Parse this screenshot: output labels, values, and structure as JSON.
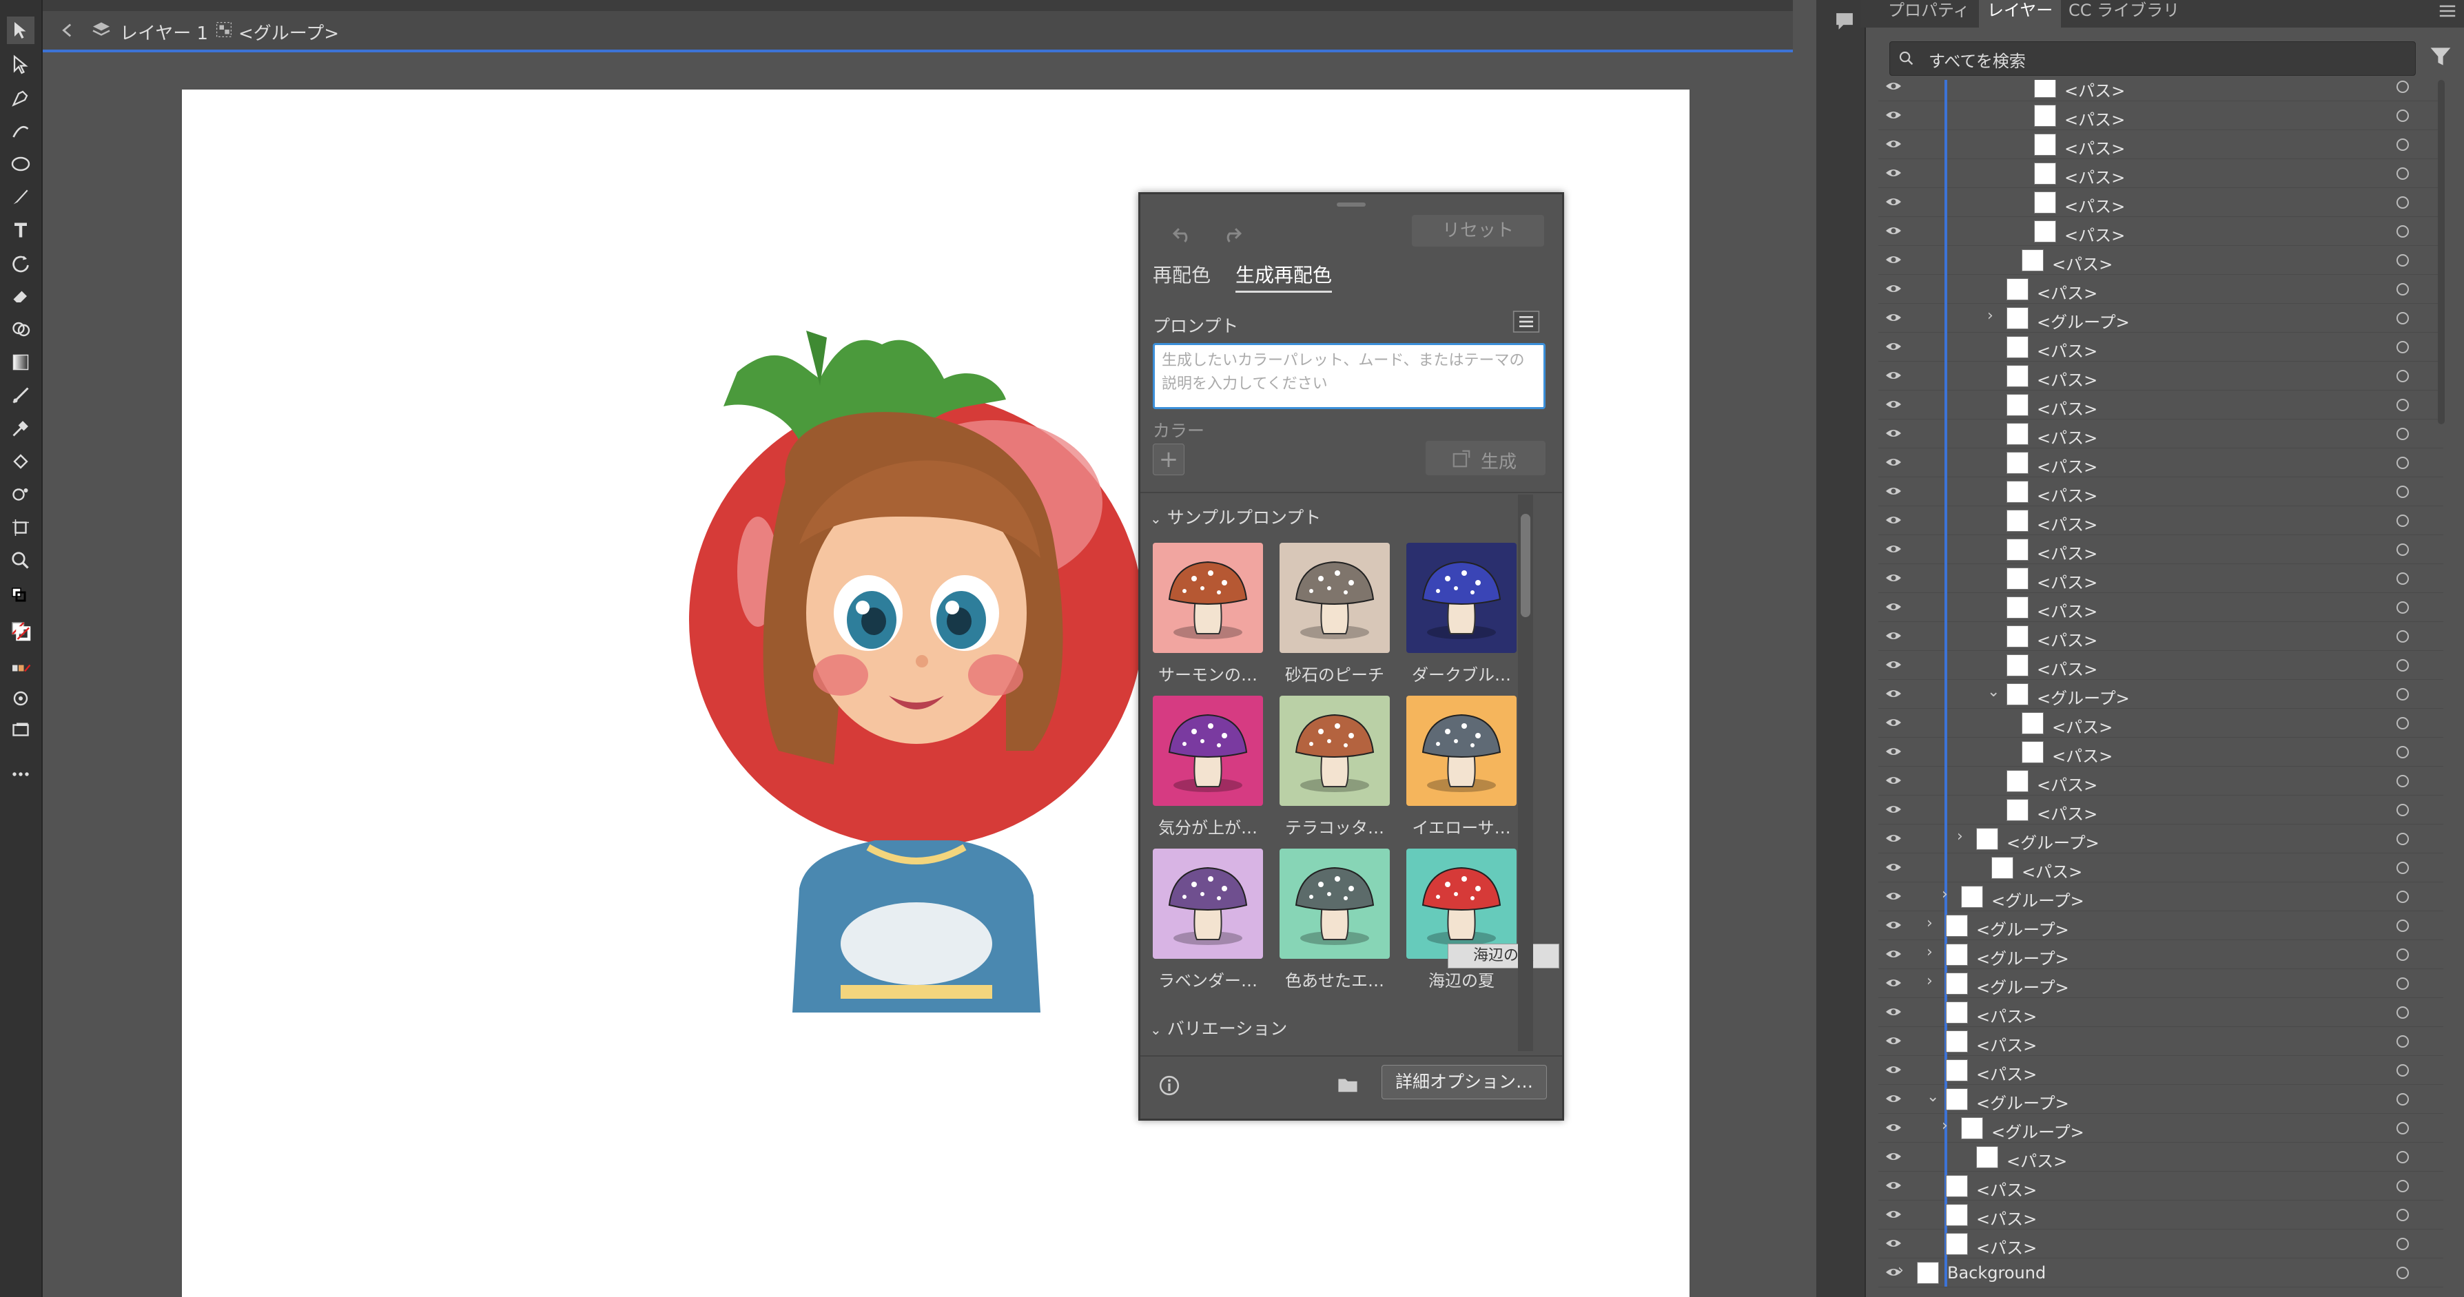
{
  "breadcrumb": {
    "layer": "レイヤー 1",
    "group": "<グループ>"
  },
  "recolor_panel": {
    "reset_label": "リセット",
    "tabs": [
      "再配色",
      "生成再配色"
    ],
    "prompt_label": "プロンプト",
    "prompt_placeholder": "生成したいカラーパレット、ムード、またはテーマの説明を入力してください",
    "color_label": "カラー",
    "generate_label": "生成",
    "sample_prompts_label": "サンプルプロンプト",
    "samples": [
      {
        "label": "サーモンの…",
        "bg": "#f1a5a0",
        "cap": "#b65833"
      },
      {
        "label": "砂石のピーチ",
        "bg": "#d8c7b8",
        "cap": "#7f756c"
      },
      {
        "label": "ダークブル…",
        "bg": "#2a2f6e",
        "cap": "#3a45b6"
      },
      {
        "label": "気分が上が…",
        "bg": "#d63b82",
        "cap": "#7a3aa0"
      },
      {
        "label": "テラコッタ…",
        "bg": "#bad0a6",
        "cap": "#b4633f"
      },
      {
        "label": "イエローサ…",
        "bg": "#f5b55c",
        "cap": "#5f6a75"
      },
      {
        "label": "ラベンダー…",
        "bg": "#d8b4e4",
        "cap": "#6f4f8f"
      },
      {
        "label": "色あせたエ…",
        "bg": "#87d5b6",
        "cap": "#5c6b6a"
      },
      {
        "label": "海辺の夏",
        "bg": "#66cbbb",
        "cap": "#d63a38"
      }
    ],
    "tooltip": "海辺の夏",
    "variations_label": "バリエーション",
    "details_button": "詳細オプション…"
  },
  "right_panel": {
    "tabs": [
      "プロパティ",
      "レイヤー",
      "CC ライブラリ"
    ],
    "search_placeholder": "すべてを検索",
    "layers": [
      {
        "name": "<パス>",
        "indent": 0
      },
      {
        "name": "<パス>",
        "indent": 0
      },
      {
        "name": "<パス>",
        "indent": 0
      },
      {
        "name": "<パス>",
        "indent": 0
      },
      {
        "name": "<パス>",
        "indent": 0
      },
      {
        "name": "<パス>",
        "indent": 0
      },
      {
        "name": "<パス>",
        "indent": 0
      },
      {
        "name": "<パス>",
        "indent": 0
      },
      {
        "name": "<グループ>",
        "indent": 0
      },
      {
        "name": "<パス>",
        "indent": 0
      },
      {
        "name": "<パス>",
        "indent": 0
      },
      {
        "name": "<パス>",
        "indent": 0
      },
      {
        "name": "<パス>",
        "indent": 0
      },
      {
        "name": "<パス>",
        "indent": 0
      },
      {
        "name": "<パス>",
        "indent": 0
      },
      {
        "name": "<パス>",
        "indent": 0
      },
      {
        "name": "<パス>",
        "indent": 0
      },
      {
        "name": "<パス>",
        "indent": 0
      },
      {
        "name": "<パス>",
        "indent": 0
      },
      {
        "name": "<パス>",
        "indent": 0
      },
      {
        "name": "<パス>",
        "indent": 0
      },
      {
        "name": "<グループ>",
        "indent": 0
      },
      {
        "name": "<パス>",
        "indent": 0
      },
      {
        "name": "<パス>",
        "indent": 0
      },
      {
        "name": "<パス>",
        "indent": 0
      },
      {
        "name": "<パス>",
        "indent": 0
      },
      {
        "name": "<グループ>",
        "indent": 0
      },
      {
        "name": "<パス>",
        "indent": 0
      },
      {
        "name": "<グループ>",
        "indent": 0
      },
      {
        "name": "<グループ>",
        "indent": 0
      },
      {
        "name": "<グループ>",
        "indent": 0
      },
      {
        "name": "<グループ>",
        "indent": 0
      },
      {
        "name": "<パス>",
        "indent": 0
      },
      {
        "name": "<パス>",
        "indent": 0
      },
      {
        "name": "<パス>",
        "indent": 0
      },
      {
        "name": "<グループ>",
        "indent": 0
      },
      {
        "name": "<グループ>",
        "indent": 0
      },
      {
        "name": "<パス>",
        "indent": 0
      },
      {
        "name": "<パス>",
        "indent": 0
      },
      {
        "name": "<パス>",
        "indent": 0
      },
      {
        "name": "<パス>",
        "indent": 0
      },
      {
        "name": "Background",
        "indent": 0
      }
    ]
  }
}
